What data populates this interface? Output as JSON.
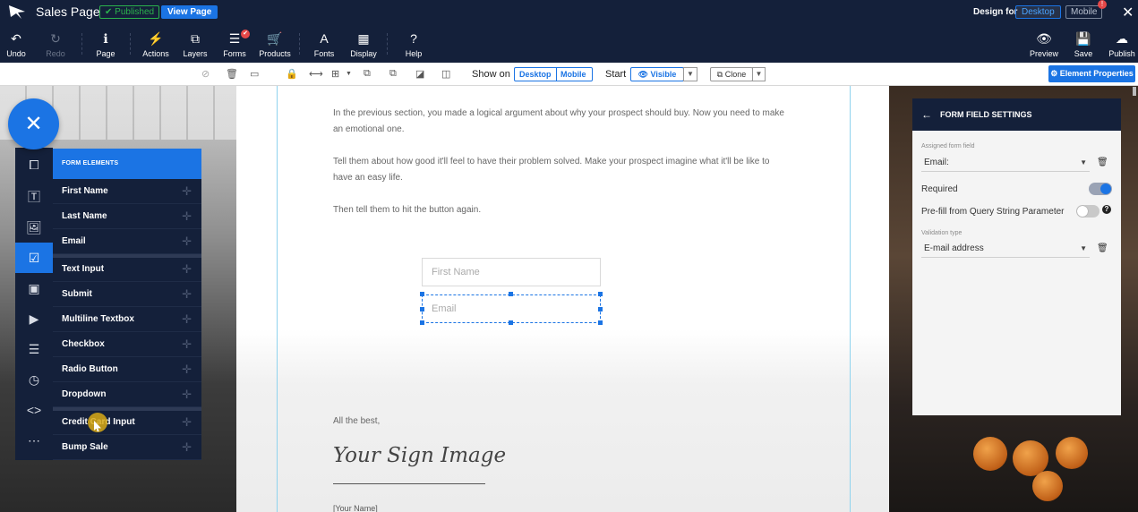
{
  "app": {
    "title": "Sales Page",
    "published_badge": "✔ Published",
    "view_page_label": "View Page",
    "design_for_label": "Design for",
    "design_desktop_label": "Desktop",
    "design_mobile_label": "Mobile",
    "mobile_alert": "!",
    "close_label": "✕"
  },
  "toolbar": {
    "items": [
      {
        "label": "Undo",
        "icon": "↶"
      },
      {
        "label": "Redo",
        "icon": "↻"
      },
      {
        "label": "Page",
        "icon": "ℹ"
      },
      {
        "label": "Actions",
        "icon": "⚡"
      },
      {
        "label": "Layers",
        "icon": "⧉"
      },
      {
        "label": "Forms",
        "icon": "☰"
      },
      {
        "label": "Products",
        "icon": "🛒"
      },
      {
        "label": "Fonts",
        "icon": "A"
      },
      {
        "label": "Display",
        "icon": "▦"
      },
      {
        "label": "Help",
        "icon": "?"
      },
      {
        "label": "Preview",
        "icon": "👁"
      },
      {
        "label": "Save",
        "icon": "💾"
      },
      {
        "label": "Publish",
        "icon": "☁"
      }
    ],
    "forms_badge": "✔"
  },
  "element_bar": {
    "show_on_label": "Show on",
    "show_desktop": "Desktop",
    "show_mobile": "Mobile",
    "start_label": "Start",
    "visible_label": "👁 Visible",
    "clone_label": "⧉ Clone",
    "element_properties_label": "⚙ Element Properties"
  },
  "page": {
    "paragraph1": "In the previous section, you made a logical argument about why your prospect should buy.  Now you need to make an emotional one.",
    "paragraph2": "Tell them about how good it'll feel to have their problem solved.  Make your prospect imagine what it'll be like to have an easy life.",
    "paragraph3": "Then tell them to hit the button again.",
    "first_name_placeholder": "First Name",
    "email_placeholder": "Email",
    "closing": "All the best,",
    "signature": "Your Sign Image",
    "your_name": "[Your Name]"
  },
  "left_panel": {
    "close_icon": "✕",
    "header": "FORM ELEMENTS",
    "items": [
      "First Name",
      "Last Name",
      "Email",
      "Text Input",
      "Submit",
      "Multiline Textbox",
      "Checkbox",
      "Radio Button",
      "Dropdown",
      "Credit Card Input",
      "Bump Sale"
    ],
    "plus_icon": "✛",
    "rail_icons": [
      "puzzle-icon",
      "text-icon",
      "image-icon",
      "checkbox-icon",
      "section-icon",
      "video-icon",
      "list-icon",
      "timer-icon",
      "code-icon",
      "more-icon"
    ]
  },
  "properties": {
    "back_icon": "←",
    "title": "FORM FIELD SETTINGS",
    "assigned_label": "Assigned form field",
    "assigned_value": "Email:",
    "required_label": "Required",
    "prefill_label": "Pre-fill from Query String Parameter",
    "help_icon": "?",
    "validation_label": "Validation type",
    "validation_value": "E-mail address",
    "trash_icon": "🗑",
    "caret_icon": "▼",
    "required_checked": true,
    "prefill_checked": false
  },
  "colors": {
    "navy": "#14203a",
    "accent": "#1b74e4",
    "published_green": "#2bb24c",
    "alert_red": "#e54848"
  }
}
